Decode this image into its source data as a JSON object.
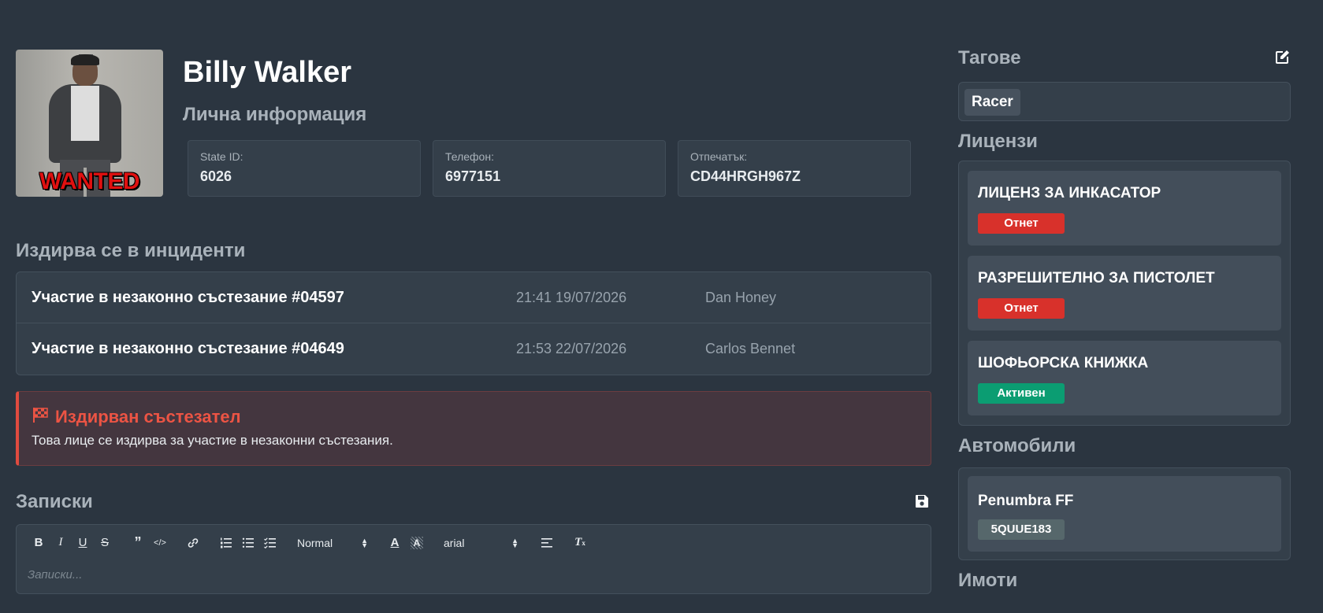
{
  "profile": {
    "name": "Billy Walker",
    "subtitle": "Лична информация",
    "mugshot_label": "WANTED",
    "fields": [
      {
        "label": "State ID:",
        "value": "6026"
      },
      {
        "label": "Телефон:",
        "value": "6977151"
      },
      {
        "label": "Отпечатък:",
        "value": "CD44HRGH967Z"
      }
    ]
  },
  "incidents": {
    "title": "Издирва се в инциденти",
    "rows": [
      {
        "title": "Участие в незаконно състезание #04597",
        "time": "21:41 19/07/2026",
        "officer": "Dan Honey"
      },
      {
        "title": "Участие в незаконно състезание #04649",
        "time": "21:53 22/07/2026",
        "officer": "Carlos Bennet"
      }
    ]
  },
  "alert": {
    "icon": "checkered-flag-icon",
    "title": "Издирван състезател",
    "text": "Това лице се издирва за участие в незаконни състезания.",
    "color": "#ec5444"
  },
  "notes": {
    "title": "Записки",
    "placeholder": "Записки...",
    "toolbar": {
      "format_select": "Normal",
      "font_select": "arial"
    }
  },
  "tags": {
    "title": "Тагове",
    "items": [
      "Racer"
    ]
  },
  "licenses": {
    "title": "Лицензи",
    "items": [
      {
        "name": "ЛИЦЕНЗ ЗА ИНКАСАТОР",
        "status": "Отнет",
        "status_color": "#d8312b"
      },
      {
        "name": "РАЗРЕШИТЕЛНО ЗА ПИСТОЛЕТ",
        "status": "Отнет",
        "status_color": "#d8312b"
      },
      {
        "name": "ШОФЬОРСКА КНИЖКА",
        "status": "Активен",
        "status_color": "#0b9d72"
      }
    ]
  },
  "vehicles": {
    "title": "Автомобили",
    "items": [
      {
        "name": "Penumbra FF",
        "plate": "5QUUE183"
      }
    ]
  },
  "properties": {
    "title": "Имоти"
  }
}
